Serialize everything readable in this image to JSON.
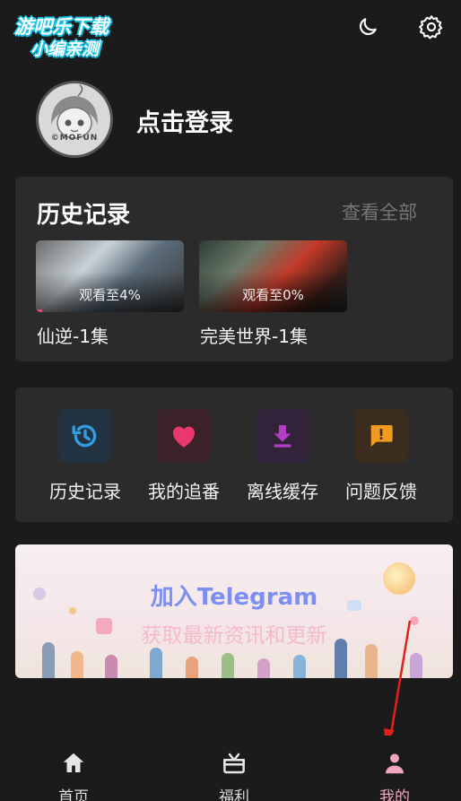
{
  "watermark": {
    "line1": "游吧乐下载",
    "line2": "小编亲测"
  },
  "header": {
    "moon_icon": "moon-icon",
    "settings_icon": "gear-icon"
  },
  "profile": {
    "avatar_text": "©MOFUN",
    "login_label": "点击登录"
  },
  "history": {
    "title": "历史记录",
    "view_all": "查看全部",
    "items": [
      {
        "progress_text": "观看至4%",
        "progress": 0.04,
        "name": "仙逆-1集"
      },
      {
        "progress_text": "观看至0%",
        "progress": 0.0,
        "name": "完美世界-1集"
      }
    ]
  },
  "menu": {
    "items": [
      {
        "label": "历史记录",
        "icon": "history-icon",
        "color": "#2f9de0",
        "bg": "#223241"
      },
      {
        "label": "我的追番",
        "icon": "heart-icon",
        "color": "#e8386d",
        "bg": "#3b2229"
      },
      {
        "label": "离线缓存",
        "icon": "download-icon",
        "color": "#b23ec6",
        "bg": "#33233a"
      },
      {
        "label": "问题反馈",
        "icon": "feedback-icon",
        "color": "#f29a1e",
        "bg": "#3a2d1f"
      }
    ]
  },
  "banner": {
    "title": "加入Telegram",
    "subtitle": "获取最新资讯和更新"
  },
  "tabbar": {
    "items": [
      {
        "label": "首页",
        "icon": "home-icon"
      },
      {
        "label": "福利",
        "icon": "gift-icon"
      },
      {
        "label": "我的",
        "icon": "user-icon",
        "active": true,
        "color": "#f0a6bd"
      }
    ]
  }
}
